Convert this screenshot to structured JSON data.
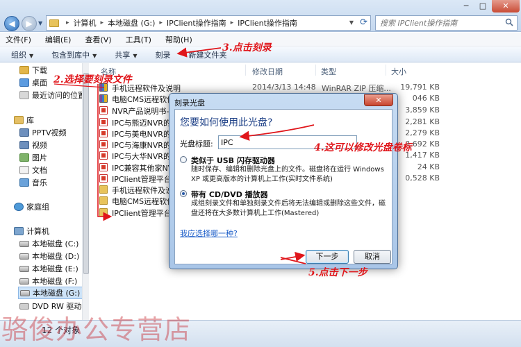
{
  "window": {
    "breadcrumbs": [
      "计算机",
      "本地磁盘 (G:)",
      "IPClient操作指南",
      "IPClient操作指南"
    ],
    "search_placeholder": "搜索 IPClient操作指南",
    "minimize": "─",
    "maximize": "□",
    "close": "✕"
  },
  "menubar": {
    "items": [
      "文件(F)",
      "编辑(E)",
      "查看(V)",
      "工具(T)",
      "帮助(H)"
    ]
  },
  "toolbar": {
    "organize": "组织",
    "include_library": "包含到库中",
    "share": "共享",
    "burn": "刻录",
    "new_folder": "新建文件夹"
  },
  "navpane": {
    "items": [
      {
        "label": "下载",
        "icon": "download-folder-icon"
      },
      {
        "label": "桌面",
        "icon": "desktop-icon"
      },
      {
        "label": "最近访问的位置",
        "icon": "recent-places-icon"
      },
      {
        "label": "库",
        "icon": "library-icon"
      },
      {
        "label": "PPTV视频",
        "icon": "video-library-icon"
      },
      {
        "label": "视频",
        "icon": "video-library-icon"
      },
      {
        "label": "图片",
        "icon": "pictures-library-icon"
      },
      {
        "label": "文档",
        "icon": "documents-library-icon"
      },
      {
        "label": "音乐",
        "icon": "music-library-icon"
      },
      {
        "label": "家庭组",
        "icon": "homegroup-icon"
      },
      {
        "label": "计算机",
        "icon": "computer-icon"
      },
      {
        "label": "本地磁盘 (C:)",
        "icon": "drive-icon"
      },
      {
        "label": "本地磁盘 (D:)",
        "icon": "drive-icon"
      },
      {
        "label": "本地磁盘 (E:)",
        "icon": "drive-icon"
      },
      {
        "label": "本地磁盘 (F:)",
        "icon": "drive-icon"
      },
      {
        "label": "本地磁盘 (G:)",
        "icon": "drive-icon"
      },
      {
        "label": "DVD RW 驱动器",
        "icon": "dvd-drive-icon"
      }
    ]
  },
  "filelist": {
    "columns": [
      "名称",
      "修改日期",
      "类型",
      "大小"
    ],
    "rows": [
      {
        "name": "手机远程软件及说明",
        "date": "2014/3/13 14:48",
        "type": "WinRAR ZIP 压缩...",
        "size": "19,791 KB",
        "icon": "rar"
      },
      {
        "name": "电脑CMS远程软件",
        "date": "",
        "type": "",
        "size": "046 KB",
        "icon": "rar"
      },
      {
        "name": "NVR产品说明书-V",
        "date": "",
        "type": "",
        "size": "3,859 KB",
        "icon": "pdf"
      },
      {
        "name": "IPC与熊迈NVR的",
        "date": "",
        "type": "",
        "size": "2,281 KB",
        "icon": "pdf"
      },
      {
        "name": "IPC与美电NVR的",
        "date": "",
        "type": "",
        "size": "2,279 KB",
        "icon": "pdf"
      },
      {
        "name": "IPC与海康NVR的",
        "date": "",
        "type": "",
        "size": "3,692 KB",
        "icon": "pdf"
      },
      {
        "name": "IPC与大华NVR的",
        "date": "",
        "type": "",
        "size": "1,417 KB",
        "icon": "pdf"
      },
      {
        "name": "IPC兼容其他家NV",
        "date": "",
        "type": "",
        "size": "24 KB",
        "icon": "pdf"
      },
      {
        "name": "IPClient管理平台",
        "date": "",
        "type": "",
        "size": "0,528 KB",
        "icon": "pdf"
      },
      {
        "name": "手机远程软件及说",
        "date": "",
        "type": "",
        "size": "",
        "icon": "folder"
      },
      {
        "name": "电脑CMS远程软件",
        "date": "",
        "type": "",
        "size": "",
        "icon": "folder"
      },
      {
        "name": "IPClient管理平台和",
        "date": "",
        "type": "",
        "size": "",
        "icon": "folder"
      }
    ]
  },
  "statusbar": {
    "text": "12 个对象"
  },
  "dialog": {
    "title": "刻录光盘",
    "heading": "您要如何使用此光盘?",
    "disc_title_label": "光盘标题:",
    "disc_title_value": "IPC",
    "option_usb": {
      "title": "类似于 USB 闪存驱动器",
      "desc": "随时保存、编辑和删除光盘上的文件。磁盘将在运行 Windows XP 或更高版本的计算机上工作(实时文件系统)"
    },
    "option_cd": {
      "title": "带有 CD/DVD 播放器",
      "desc": "成组刻录文件和单独刻录文件后将无法编辑或删除这些文件，磁盘还将在大多数计算机上工作(Mastered)"
    },
    "help_link": "我应选择哪一种?",
    "next_button": "下一步",
    "cancel_button": "取消"
  },
  "annotations": {
    "step2": "2.选择要刻录文件",
    "step3": "3.点击刻录",
    "step4": "4.这可以修改光盘卷标",
    "step5": "5.点击下一步"
  },
  "watermark": "骆俊办公专营店",
  "colors": {
    "annotation_red": "#e0161b",
    "dialog_heading_blue": "#1c3f86",
    "link_blue": "#1a5cc8",
    "watermark": "#c8323c"
  }
}
